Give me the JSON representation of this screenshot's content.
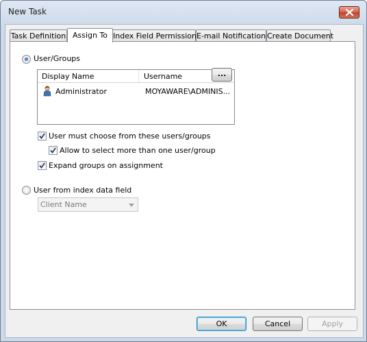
{
  "window": {
    "title": "New Task"
  },
  "tabs": [
    {
      "label": "Task Definition",
      "active": false
    },
    {
      "label": "Assign To",
      "active": true
    },
    {
      "label": "Index Field Permissions",
      "active": false
    },
    {
      "label": "E-mail Notifications",
      "active": false
    },
    {
      "label": "Create Document",
      "active": false
    }
  ],
  "assign": {
    "user_groups_label": "User/Groups",
    "user_groups_selected": true,
    "list": {
      "columns": [
        "Display Name",
        "Username"
      ],
      "rows": [
        {
          "icon": "user-icon",
          "display_name": "Administrator",
          "username": "MOYAWARE\\ADMINIS..."
        }
      ]
    },
    "browse_label": "...",
    "must_choose_label": "User must choose from these users/groups",
    "must_choose_checked": true,
    "allow_multiple_label": "Allow to select more than one user/group",
    "allow_multiple_checked": true,
    "expand_groups_label": "Expand groups on assignment",
    "expand_groups_checked": true,
    "index_field_label": "User from index data field",
    "index_field_selected": false,
    "index_field_combo": {
      "value": "Client Name",
      "enabled": false
    }
  },
  "buttons": {
    "ok": "OK",
    "cancel": "Cancel",
    "apply": "Apply",
    "apply_enabled": false
  }
}
